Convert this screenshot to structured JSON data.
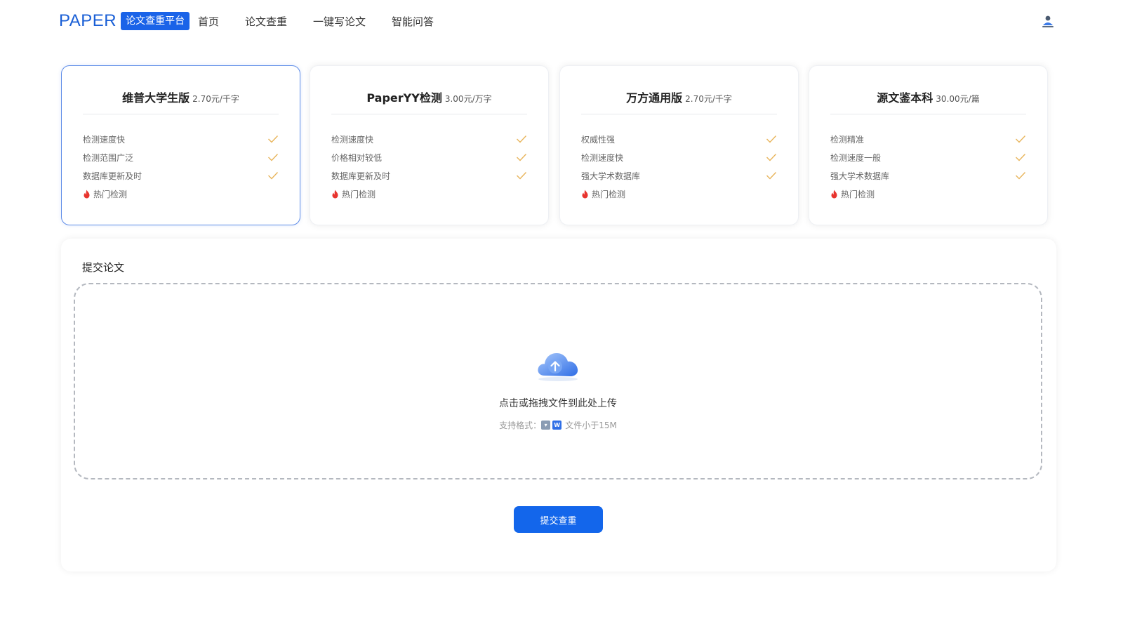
{
  "header": {
    "brand_name": "PAPER",
    "brand_tag": "论文查重平台",
    "nav": [
      {
        "label": "首页"
      },
      {
        "label": "论文查重"
      },
      {
        "label": "一键写论文"
      },
      {
        "label": "智能问答"
      }
    ],
    "user_icon": "user-icon"
  },
  "cards": [
    {
      "name": "维普大学生版",
      "price": "2.70元/千字",
      "selected": true,
      "features": [
        "检测速度快",
        "检测范围广泛",
        "数据库更新及时"
      ],
      "hot": "热门检测"
    },
    {
      "name": "PaperYY检测",
      "price": "3.00元/万字",
      "selected": false,
      "features": [
        "检测速度快",
        "价格相对较低",
        "数据库更新及时"
      ],
      "hot": "热门检测"
    },
    {
      "name": "万方通用版",
      "price": "2.70元/千字",
      "selected": false,
      "features": [
        "权威性强",
        "检测速度快",
        "强大学术数据库"
      ],
      "hot": "热门检测"
    },
    {
      "name": "源文鉴本科",
      "price": "30.00元/篇",
      "selected": false,
      "features": [
        "检测精准",
        "检测速度一般",
        "强大学术数据库"
      ],
      "hot": "热门检测"
    }
  ],
  "panel": {
    "title": "提交论文",
    "upload_text": "点击或拖拽文件到此处上传",
    "format_label": "支持格式：",
    "format_size": "文件小于15M",
    "submit_label": "提交查重"
  },
  "colors": {
    "brand": "#1a5fd6",
    "accent": "#1366eb",
    "check": "#e8b45a",
    "hot": "#e8342e"
  }
}
